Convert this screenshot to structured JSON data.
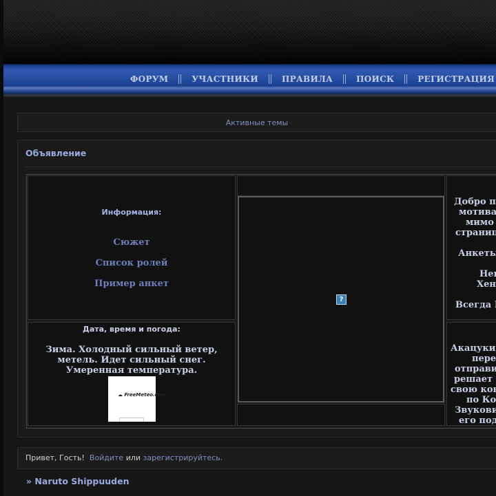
{
  "nav": {
    "items": [
      "ФОРУМ",
      "УЧАСТНИКИ",
      "ПРАВИЛА",
      "ПОИСК",
      "РЕГИСТРАЦИЯ"
    ]
  },
  "active_topics": "Активные темы",
  "announcement": {
    "title": "Объявление",
    "info": {
      "title": "Информация:",
      "links": [
        "Сюжет",
        "Список ролей",
        "Пример анкет"
      ]
    },
    "weather": {
      "title": "Дата, время и погода:",
      "text": "Зима. Холодный сильный ветер, метель. Идет сильный снег. Умеренная температура.",
      "widget_logo": "FreeMeteo.com"
    },
    "center_image": {
      "icon": "broken-image-icon",
      "glyph": "?"
    },
    "right_top_lines": [
      "Добро по",
      "мотивам",
      "мимо л",
      "страниц",
      "",
      "Анкеты",
      "",
      "Нек",
      "Хент",
      "",
      "Всегда В"
    ],
    "right_bottom_lines": [
      "Акацуки:",
      "перем",
      "отправиз",
      "решает о",
      "свою кон",
      "по Ко",
      "Звукови",
      "его подч"
    ]
  },
  "greeting": {
    "prefix": "Привет, Гость!",
    "login": "Войдите",
    "or": "или",
    "register": "зарегистрируйтесь."
  },
  "forum_link": "» Naruto Shippuuden"
}
